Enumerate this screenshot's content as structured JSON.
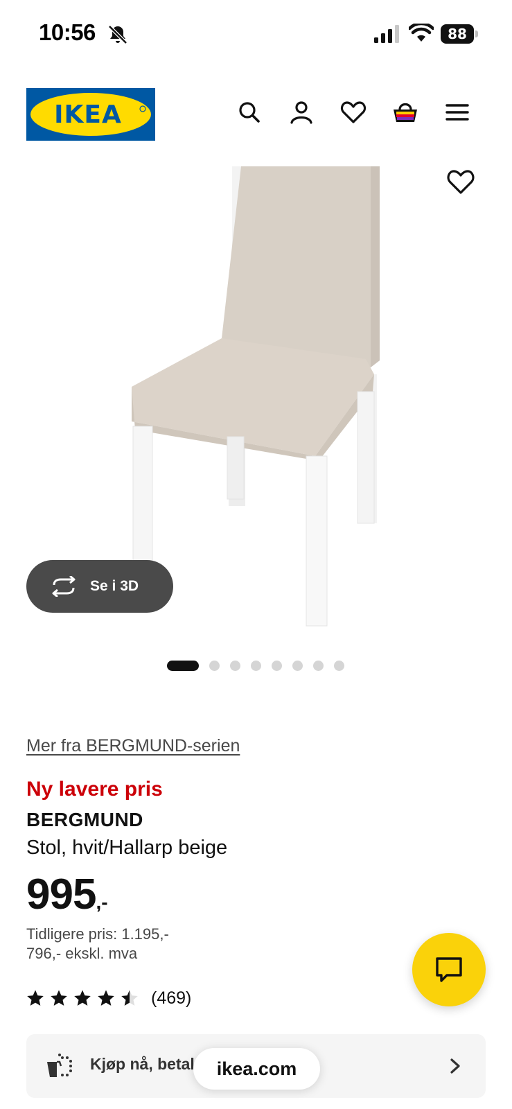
{
  "status_bar": {
    "time": "10:56",
    "battery": "88",
    "icons": [
      "bell-slash-icon",
      "cellular-signal-icon",
      "wifi-icon",
      "battery-icon"
    ]
  },
  "header": {
    "logo_text": "IKEA",
    "icons": [
      "search-icon",
      "user-icon",
      "heart-icon",
      "basket-icon",
      "hamburger-menu-icon"
    ]
  },
  "gallery": {
    "button_3d_label": "Se i 3D",
    "image_count": 8,
    "active_index": 0
  },
  "product": {
    "series_link": "Mer fra BERGMUND-serien",
    "badge": "Ny lavere pris",
    "name": "BERGMUND",
    "description": "Stol, hvit/Hallarp beige",
    "price_integer": "995",
    "price_decimal": ",-",
    "previous_price": "Tidligere pris: 1.195,-",
    "price_ex_vat": "796,- ekskl. mva",
    "rating_value": 4.5,
    "rating_max": 5,
    "review_count": "(469)"
  },
  "bnpl": {
    "label": "Kjøp nå, betal senere"
  },
  "browser": {
    "url": "ikea.com"
  },
  "colors": {
    "brand_blue": "#0058a3",
    "brand_yellow": "#ffdb00",
    "badge_red": "#cc0008",
    "chat_yellow": "#fad20a"
  }
}
